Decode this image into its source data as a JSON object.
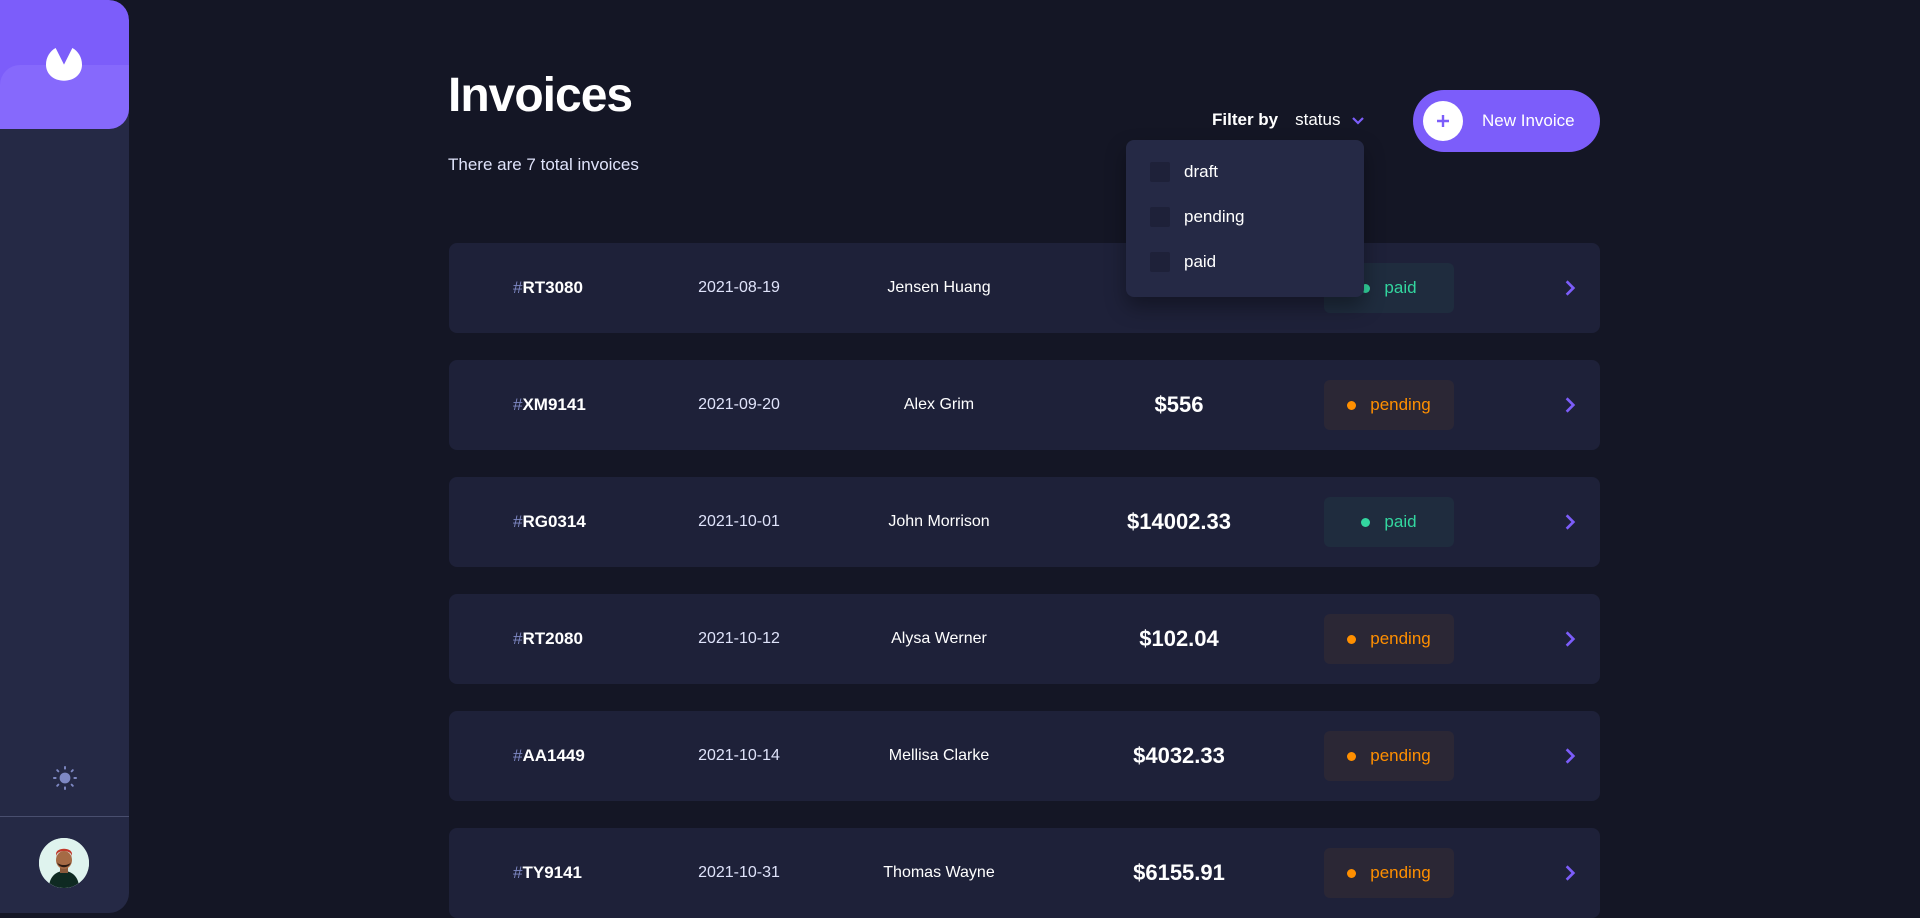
{
  "header": {
    "title": "Invoices",
    "subtitle": "There are 7 total invoices"
  },
  "filter": {
    "label": "Filter by",
    "value": "status",
    "options": [
      {
        "label": "draft",
        "checked": false
      },
      {
        "label": "pending",
        "checked": false
      },
      {
        "label": "paid",
        "checked": false
      }
    ]
  },
  "new_invoice": {
    "label": "New Invoice"
  },
  "sidebar": {
    "logo_icon": "logo-icon",
    "theme_icon": "sun-icon",
    "avatar_icon": "avatar"
  },
  "colors": {
    "accent": "#7c5dfa",
    "background": "#141625",
    "card": "#1e2139",
    "paid": "#33d69f",
    "pending": "#ff8f00"
  },
  "invoices": [
    {
      "hash": "#",
      "id": "RT3080",
      "date": "2021-08-19",
      "name": "Jensen Huang",
      "amount": "",
      "status": "paid"
    },
    {
      "hash": "#",
      "id": "XM9141",
      "date": "2021-09-20",
      "name": "Alex Grim",
      "amount": "$556",
      "status": "pending"
    },
    {
      "hash": "#",
      "id": "RG0314",
      "date": "2021-10-01",
      "name": "John Morrison",
      "amount": "$14002.33",
      "status": "paid"
    },
    {
      "hash": "#",
      "id": "RT2080",
      "date": "2021-10-12",
      "name": "Alysa Werner",
      "amount": "$102.04",
      "status": "pending"
    },
    {
      "hash": "#",
      "id": "AA1449",
      "date": "2021-10-14",
      "name": "Mellisa Clarke",
      "amount": "$4032.33",
      "status": "pending"
    },
    {
      "hash": "#",
      "id": "TY9141",
      "date": "2021-10-31",
      "name": "Thomas Wayne",
      "amount": "$6155.91",
      "status": "pending"
    }
  ]
}
